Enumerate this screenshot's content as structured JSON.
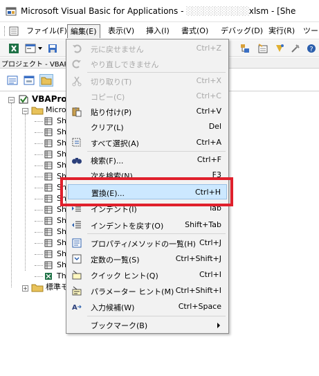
{
  "window": {
    "title": "Microsoft Visual Basic for Applications - ",
    "title_file_suffix": "xlsm - [She",
    "title_blurred_part": "░░░░░░░░░░░"
  },
  "menubar": {
    "items": [
      {
        "label": "ファイル(F)",
        "open": false
      },
      {
        "label": "編集(E)",
        "open": true
      },
      {
        "label": "表示(V)",
        "open": false
      },
      {
        "label": "挿入(I)",
        "open": false
      },
      {
        "label": "書式(O)",
        "open": false
      },
      {
        "label": "デバッグ(D)",
        "open": false
      },
      {
        "label": "実行(R)",
        "open": false
      },
      {
        "label": "ツー",
        "open": false
      }
    ]
  },
  "project_panel": {
    "title": "プロジェクト - VBAPro"
  },
  "tree": {
    "root_label": "VBAPro",
    "folder_label": "Micro",
    "sheet_prefix": "Sh",
    "thisworkbook_label": "Th",
    "std_module_label": "標準モ"
  },
  "edit_menu": {
    "items": [
      {
        "label": "元に戻せません",
        "shortcut": "Ctrl+Z",
        "icon": "undo-icon",
        "disabled": true
      },
      {
        "label": "やり直しできません",
        "shortcut": "",
        "icon": "redo-icon",
        "disabled": true
      },
      {
        "label": "切り取り(T)",
        "shortcut": "Ctrl+X",
        "icon": "cut-icon",
        "disabled": true
      },
      {
        "label": "コピー(C)",
        "shortcut": "Ctrl+C",
        "icon": "copy-icon",
        "disabled": true
      },
      {
        "label": "貼り付け(P)",
        "shortcut": "Ctrl+V",
        "icon": "paste-icon",
        "disabled": false
      },
      {
        "label": "クリア(L)",
        "shortcut": "Del",
        "icon": "",
        "disabled": false
      },
      {
        "label": "すべて選択(A)",
        "shortcut": "Ctrl+A",
        "icon": "select-all-icon",
        "disabled": false
      },
      {
        "label": "検索(F)...",
        "shortcut": "Ctrl+F",
        "icon": "binoculars-icon",
        "disabled": false
      },
      {
        "label": "次を検索(N)",
        "shortcut": "F3",
        "icon": "",
        "disabled": false
      },
      {
        "label": "置換(E)...",
        "shortcut": "Ctrl+H",
        "icon": "",
        "disabled": false,
        "highlighted": true
      },
      {
        "label": "インデント(I)",
        "shortcut": "Tab",
        "icon": "indent-icon",
        "disabled": false
      },
      {
        "label": "インデントを戻す(O)",
        "shortcut": "Shift+Tab",
        "icon": "outdent-icon",
        "disabled": false
      },
      {
        "label": "プロパティ/メソッドの一覧(H)",
        "shortcut": "Ctrl+J",
        "icon": "property-list-icon",
        "disabled": false
      },
      {
        "label": "定数の一覧(S)",
        "shortcut": "Ctrl+Shift+J",
        "icon": "constant-list-icon",
        "disabled": false
      },
      {
        "label": "クイック ヒント(Q)",
        "shortcut": "Ctrl+I",
        "icon": "quick-info-icon",
        "disabled": false
      },
      {
        "label": "パラメーター ヒント(M)",
        "shortcut": "Ctrl+Shift+I",
        "icon": "parameter-info-icon",
        "disabled": false
      },
      {
        "label": "入力候補(W)",
        "shortcut": "Ctrl+Space",
        "icon": "complete-word-icon",
        "disabled": false
      },
      {
        "label": "ブックマーク(B)",
        "shortcut": "",
        "icon": "",
        "disabled": false,
        "submenu": true
      }
    ]
  },
  "colors": {
    "highlight_bg": "#cce8ff",
    "highlight_border": "#9ac0e4",
    "annotation_red": "#e0202c",
    "disabled_text": "#a8a8a8"
  }
}
